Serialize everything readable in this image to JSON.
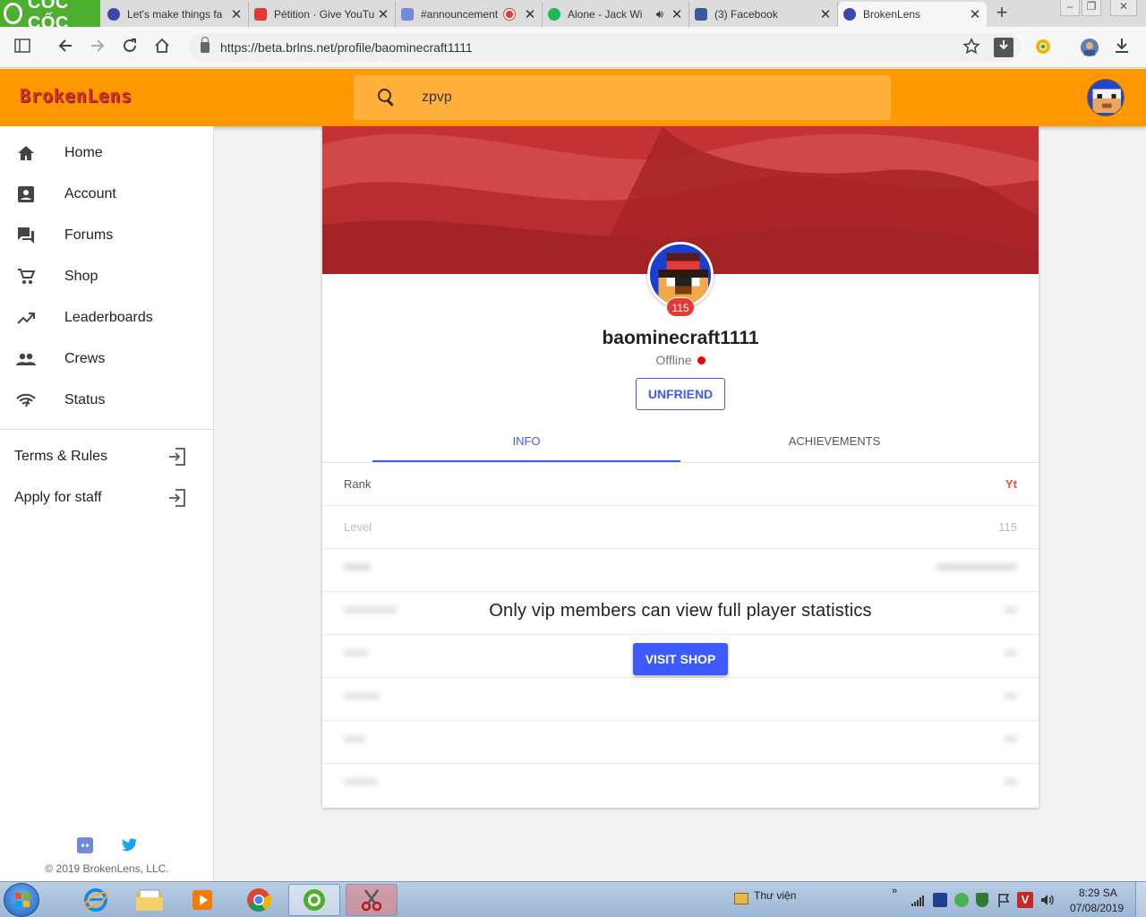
{
  "browser": {
    "brand_tab": "CỐC CỐC",
    "tabs": [
      {
        "title": "Let's make things fa",
        "color": "#3949ab"
      },
      {
        "title": "Pétition · Give YouTu",
        "color": "#e53935"
      },
      {
        "title": "#announcement",
        "color": "#7289da"
      },
      {
        "title": "Alone - Jack Wi",
        "color": "#1db954"
      },
      {
        "title": "(3) Facebook",
        "color": "#3b5998"
      },
      {
        "title": "BrokenLens",
        "color": "#3949ab"
      }
    ],
    "new_tab": "+",
    "url": "https://beta.brlns.net/profile/baominecraft1111"
  },
  "site": {
    "logo": "BrokenLens",
    "search_value": "zpvp",
    "accent_color": "#ff9800",
    "primary_color": "#3d5afe"
  },
  "sidebar": {
    "items": [
      {
        "label": "Home",
        "icon": "home-icon"
      },
      {
        "label": "Account",
        "icon": "account-box-icon"
      },
      {
        "label": "Forums",
        "icon": "forum-icon"
      },
      {
        "label": "Shop",
        "icon": "cart-icon"
      },
      {
        "label": "Leaderboards",
        "icon": "trending-up-icon"
      },
      {
        "label": "Crews",
        "icon": "people-icon"
      },
      {
        "label": "Status",
        "icon": "signal-icon"
      }
    ],
    "links": [
      {
        "label": "Terms & Rules",
        "icon": "exit-icon"
      },
      {
        "label": "Apply for staff",
        "icon": "exit-icon"
      }
    ],
    "social": [
      "discord-icon",
      "twitter-icon"
    ],
    "copyright": "© 2019 BrokenLens, LLC."
  },
  "profile": {
    "username": "baominecraft1111",
    "level_badge": "115",
    "status": "Offline",
    "unfriend_label": "UNFRIEND",
    "tabs": [
      "INFO",
      "ACHIEVEMENTS"
    ],
    "active_tab": "INFO",
    "rows": [
      {
        "label": "Rank",
        "value": "Yt"
      },
      {
        "label": "Level",
        "value": "115"
      }
    ],
    "vip_message": "Only vip members can view full player statistics",
    "visit_shop_label": "VISIT SHOP"
  },
  "taskbar": {
    "tray_folder": "Thư viện",
    "time": "8:29 SA",
    "date": "07/08/2019"
  }
}
